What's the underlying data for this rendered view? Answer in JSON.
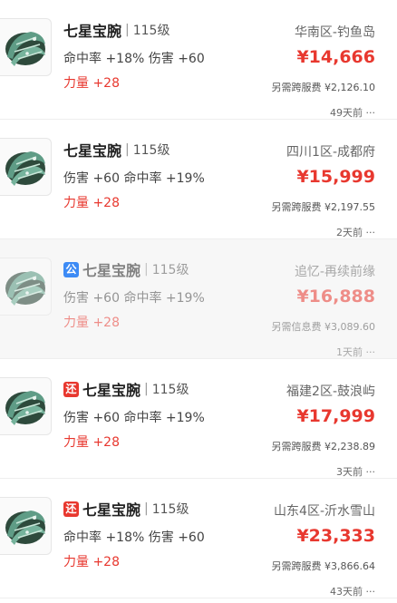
{
  "listings": [
    {
      "badge": "",
      "title": "七星宝腕",
      "separator": "|",
      "level": "115级",
      "stats": "命中率 +18% 伤害 +60",
      "bonus": "力量 +28",
      "server": "华南区-钓鱼岛",
      "price": "¥14,666",
      "fee": "另需跨服费 ¥2,126.10",
      "time": "49天前 ···",
      "dimmed": false
    },
    {
      "badge": "",
      "title": "七星宝腕",
      "separator": "|",
      "level": "115级",
      "stats": "伤害 +60 命中率 +19%",
      "bonus": "力量 +28",
      "server": "四川1区-成都府",
      "price": "¥15,999",
      "fee": "另需跨服费 ¥2,197.55",
      "time": "2天前 ···",
      "dimmed": false
    },
    {
      "badge": "公",
      "title": "七星宝腕",
      "separator": "|",
      "level": "115级",
      "stats": "伤害 +60 命中率 +19%",
      "bonus": "力量 +28",
      "server": "追忆-再续前缘",
      "price": "¥16,888",
      "fee": "另需信息费 ¥3,089.60",
      "time": "1天前 ···",
      "dimmed": true
    },
    {
      "badge": "还",
      "title": "七星宝腕",
      "separator": "|",
      "level": "115级",
      "stats": "伤害 +60 命中率 +19%",
      "bonus": "力量 +28",
      "server": "福建2区-鼓浪屿",
      "price": "¥17,999",
      "fee": "另需跨服费 ¥2,238.89",
      "time": "3天前 ···",
      "dimmed": false
    },
    {
      "badge": "还",
      "title": "七星宝腕",
      "separator": "|",
      "level": "115级",
      "stats": "命中率 +18% 伤害 +60",
      "bonus": "力量 +28",
      "server": "山东4区-沂水雪山",
      "price": "¥23,333",
      "fee": "另需跨服费 ¥3,866.64",
      "time": "43天前 ···",
      "dimmed": false
    }
  ],
  "colors": {
    "price": "#e8382f",
    "badge_public": "#3d8bf5",
    "badge_return": "#e8382f"
  },
  "icons": {
    "item": "bracer-item-icon",
    "badge_public": "public-badge-icon",
    "badge_return": "return-badge-icon"
  }
}
